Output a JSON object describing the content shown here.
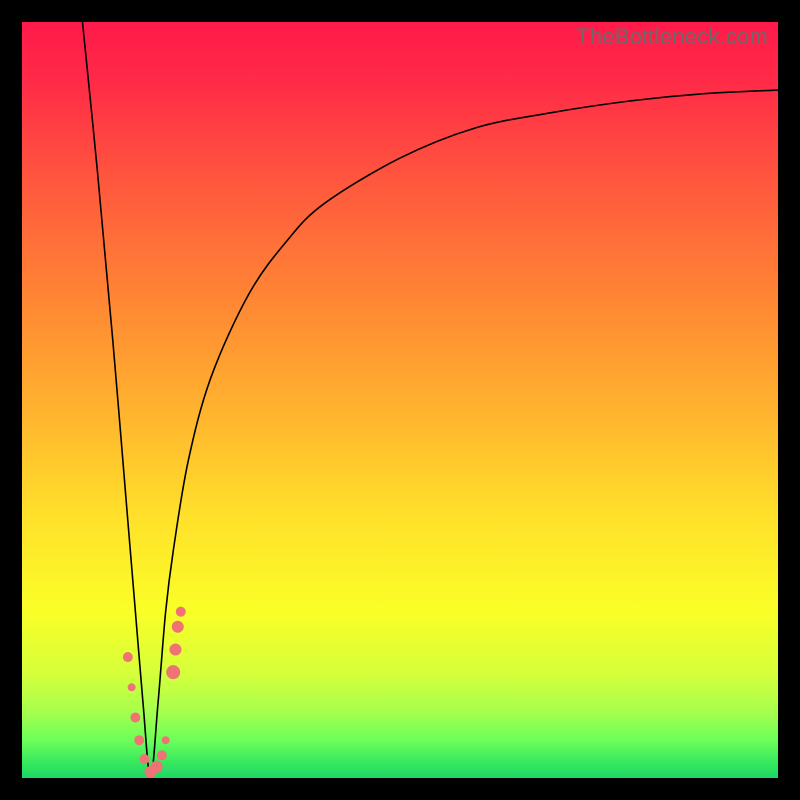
{
  "watermark": "TheBottleneck.com",
  "colors": {
    "background_frame": "#000000",
    "gradient_top": "#ff1a4a",
    "gradient_bottom": "#1fd665",
    "curve": "#000000",
    "markers": "#f07373"
  },
  "chart_data": {
    "type": "line",
    "title": "",
    "xlabel": "",
    "ylabel": "",
    "xlim": [
      0,
      100
    ],
    "ylim": [
      0,
      100
    ],
    "grid": false,
    "legend": false,
    "description": "Bottleneck-style V curve: steep descent on the left to a minimum around x≈17 (y≈0), then a concave rise approaching y≈90 at x=100.",
    "series": [
      {
        "name": "curve",
        "x": [
          8,
          10,
          12,
          14,
          15,
          16,
          17,
          18,
          19,
          20,
          22,
          25,
          30,
          35,
          40,
          50,
          60,
          70,
          80,
          90,
          100
        ],
        "y": [
          100,
          80,
          58,
          34,
          22,
          10,
          0,
          10,
          22,
          30,
          42,
          53,
          64,
          71,
          76,
          82,
          86,
          88,
          89.5,
          90.5,
          91
        ]
      }
    ],
    "markers": [
      {
        "x": 14.0,
        "y": 16.0,
        "r": 5
      },
      {
        "x": 14.5,
        "y": 12.0,
        "r": 4
      },
      {
        "x": 15.0,
        "y": 8.0,
        "r": 5
      },
      {
        "x": 15.5,
        "y": 5.0,
        "r": 5
      },
      {
        "x": 16.2,
        "y": 2.5,
        "r": 5
      },
      {
        "x": 17.0,
        "y": 0.8,
        "r": 6
      },
      {
        "x": 17.8,
        "y": 1.5,
        "r": 6
      },
      {
        "x": 18.5,
        "y": 3.0,
        "r": 5
      },
      {
        "x": 19.0,
        "y": 5.0,
        "r": 4
      },
      {
        "x": 20.0,
        "y": 14.0,
        "r": 7
      },
      {
        "x": 20.3,
        "y": 17.0,
        "r": 6
      },
      {
        "x": 20.6,
        "y": 20.0,
        "r": 6
      },
      {
        "x": 21.0,
        "y": 22.0,
        "r": 5
      }
    ]
  }
}
